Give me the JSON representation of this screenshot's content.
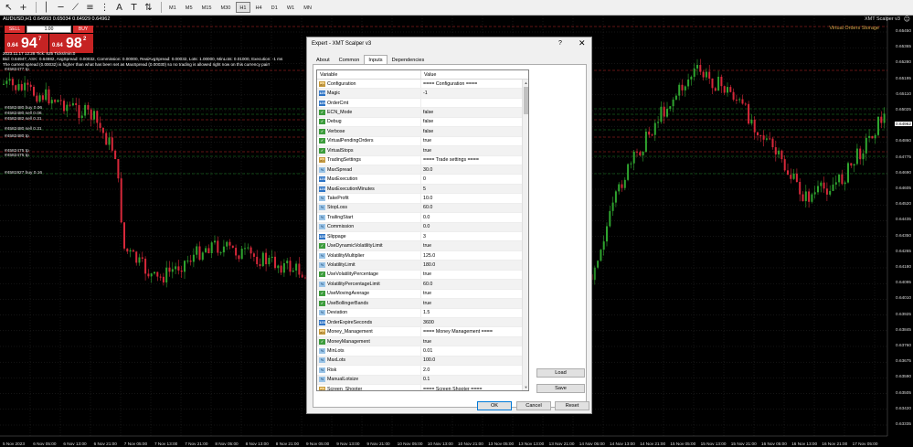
{
  "toolbar": {
    "timeframes": [
      "M1",
      "M5",
      "M15",
      "M30",
      "H1",
      "H4",
      "D1",
      "W1",
      "MN"
    ],
    "active_timeframe": "H1"
  },
  "chart": {
    "symbol_line": "AUDUSD,H1  0.64993 0.65034 0.64929 0.64962",
    "ea_name": "XMT Scalper v3",
    "ea_face": "☺",
    "virtual_orders": "Virtual Orders Storage",
    "trade_panel": {
      "sell_label": "SELL",
      "buy_label": "BUY",
      "lot_value": "1.00",
      "sell_small": "0.64",
      "sell_big": "94",
      "sell_sup": "7",
      "buy_small": "0.64",
      "buy_big": "98",
      "buy_sup": "2"
    },
    "info_lines": [
      "2023.11.17 12:28  Tick: 825 Ticks/min:0",
      "Bid: 0.64947, ASK: 0.64982, AvgSpread: 0.00032, Commission: 0.00000, RealAvgSpread: 0.00032, Lots: 1.00000, MinLots: 0.01000, Execution: -1 ms",
      "The current spread (0.00032) is higher than what has been set as MaxSpread (0.00030) so no trading is allowed right now on this currency pair!"
    ],
    "order_labels": [
      "#4582477 tp",
      "#4582480 buy 0.06",
      "#4582480 sell 0.06",
      "#4582482 sell 0.31",
      "#4582480 sell 0.31",
      "#4582480 tp",
      "#4582475 tp",
      "#4582475 tp",
      "#4581927 buy 0.16"
    ],
    "price_ticks": [
      "0.65450",
      "0.65365",
      "0.65280",
      "0.65195",
      "0.65110",
      "0.65025",
      "0.64940",
      "0.64860",
      "0.64775",
      "0.64690",
      "0.64605",
      "0.64520",
      "0.64435",
      "0.64350",
      "0.64265",
      "0.64180",
      "0.64095",
      "0.64010",
      "0.63925",
      "0.63845",
      "0.63760",
      "0.63675",
      "0.63590",
      "0.63505",
      "0.63420",
      "0.63335"
    ],
    "current_price": "0.64962",
    "date_ticks": [
      "5 Nov 2023",
      "6 Nov 05:00",
      "6 Nov 13:00",
      "6 Nov 21:00",
      "7 Nov 05:00",
      "7 Nov 13:00",
      "7 Nov 21:00",
      "8 Nov 05:00",
      "8 Nov 13:00",
      "8 Nov 21:00",
      "9 Nov 05:00",
      "9 Nov 13:00",
      "9 Nov 21:00",
      "10 Nov 05:00",
      "10 Nov 13:00",
      "10 Nov 21:00",
      "13 Nov 05:00",
      "13 Nov 13:00",
      "13 Nov 21:00",
      "14 Nov 05:00",
      "14 Nov 13:00",
      "14 Nov 21:00",
      "15 Nov 05:00",
      "15 Nov 13:00",
      "15 Nov 21:00",
      "16 Nov 05:00",
      "16 Nov 13:00",
      "16 Nov 21:00",
      "17 Nov 05:00"
    ],
    "colors": {
      "bull": "#2fa52f",
      "bear": "#d7283a",
      "grid": "#2a2a2a",
      "order_green": "#1f8a2a",
      "order_red": "#c42828"
    }
  },
  "dialog": {
    "title": "Expert - XMT Scalper v3",
    "help": "?",
    "close": "✕",
    "tabs": [
      "About",
      "Common",
      "Inputs",
      "Dependencies"
    ],
    "active_tab": "Inputs",
    "header": {
      "variable": "Variable",
      "value": "Value"
    },
    "rows": [
      {
        "icon": "ab",
        "name": "Configuration",
        "value": "==== Configuration ===="
      },
      {
        "icon": "i",
        "name": "Magic",
        "value": "-1"
      },
      {
        "icon": "i",
        "name": "OrderCmt",
        "value": ""
      },
      {
        "icon": "b",
        "name": "ECN_Mode",
        "value": "false"
      },
      {
        "icon": "b",
        "name": "Debug",
        "value": "false"
      },
      {
        "icon": "b",
        "name": "Verbose",
        "value": "false"
      },
      {
        "icon": "b",
        "name": "VirtualPendingOrders",
        "value": "true"
      },
      {
        "icon": "b",
        "name": "VirtualStops",
        "value": "true"
      },
      {
        "icon": "ab",
        "name": "TradingSettings",
        "value": "==== Trade settings ===="
      },
      {
        "icon": "d",
        "name": "MaxSpread",
        "value": "30.0"
      },
      {
        "icon": "i",
        "name": "MaxExecution",
        "value": "0"
      },
      {
        "icon": "i",
        "name": "MaxExecutionMinutes",
        "value": "5"
      },
      {
        "icon": "d",
        "name": "TakeProfit",
        "value": "10.0"
      },
      {
        "icon": "d",
        "name": "StopLoss",
        "value": "60.0"
      },
      {
        "icon": "d",
        "name": "TrailingStart",
        "value": "0.0"
      },
      {
        "icon": "d",
        "name": "Commission",
        "value": "0.0"
      },
      {
        "icon": "i",
        "name": "Slippage",
        "value": "3"
      },
      {
        "icon": "b",
        "name": "UseDynamicVolatilityLimit",
        "value": "true"
      },
      {
        "icon": "d",
        "name": "VolatilityMultiplier",
        "value": "125.0"
      },
      {
        "icon": "d",
        "name": "VolatilityLimit",
        "value": "180.0"
      },
      {
        "icon": "b",
        "name": "UseVolatilityPercentage",
        "value": "true"
      },
      {
        "icon": "d",
        "name": "VolatilityPercentageLimit",
        "value": "60.0"
      },
      {
        "icon": "b",
        "name": "UseMovingAverage",
        "value": "true"
      },
      {
        "icon": "b",
        "name": "UseBollingerBands",
        "value": "true"
      },
      {
        "icon": "d",
        "name": "Deviation",
        "value": "1.5"
      },
      {
        "icon": "i",
        "name": "OrderExpireSeconds",
        "value": "3600"
      },
      {
        "icon": "ab",
        "name": "Money_Management",
        "value": "==== Money Management ===="
      },
      {
        "icon": "b",
        "name": "MoneyManagement",
        "value": "true"
      },
      {
        "icon": "d",
        "name": "MinLots",
        "value": "0.01"
      },
      {
        "icon": "d",
        "name": "MaxLots",
        "value": "100.0"
      },
      {
        "icon": "d",
        "name": "Risk",
        "value": "2.0"
      },
      {
        "icon": "d",
        "name": "ManualLotsize",
        "value": "0.1"
      },
      {
        "icon": "ab",
        "name": "Screen_Shooter",
        "value": "==== Screen Shooter ===="
      }
    ],
    "load_label": "Load",
    "save_label": "Save",
    "ok_label": "OK",
    "cancel_label": "Cancel",
    "reset_label": "Reset"
  }
}
